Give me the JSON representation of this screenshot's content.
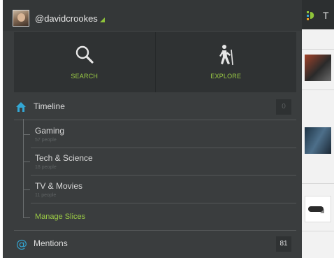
{
  "header": {
    "username": "@davidcrookes"
  },
  "actions": [
    {
      "label": "SEARCH",
      "icon": "search-icon"
    },
    {
      "label": "EXPLORE",
      "icon": "hiker-icon"
    }
  ],
  "timeline": {
    "label": "Timeline",
    "count": "0",
    "icon": "home-icon"
  },
  "slices": [
    {
      "name": "Gaming",
      "meta": "57 people"
    },
    {
      "name": "Tech & Science",
      "meta": "18 people"
    },
    {
      "name": "TV & Movies",
      "meta": "11 people"
    }
  ],
  "manage_slices": "Manage Slices",
  "mentions": {
    "label": "Mentions",
    "count": "81",
    "icon": "at-icon"
  },
  "strip": {
    "title_initial": "T"
  },
  "colors": {
    "accent": "#9bcb45",
    "drawer_bg": "#3a3d3e",
    "home_icon": "#33a7d4"
  }
}
